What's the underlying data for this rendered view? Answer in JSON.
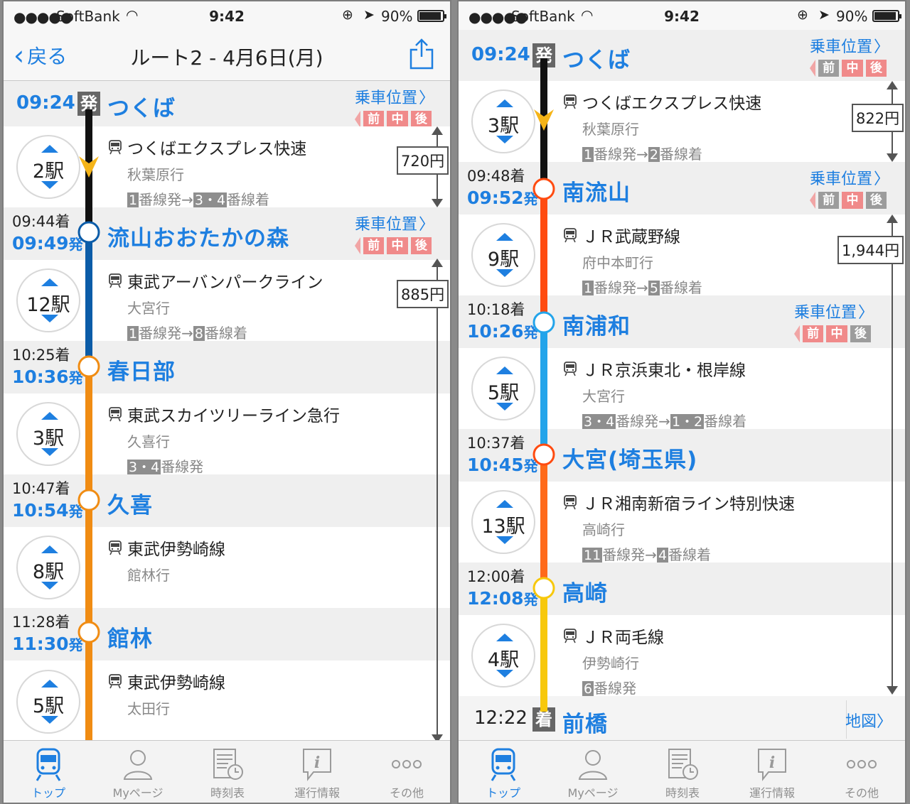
{
  "status": {
    "signal": "●●●●●",
    "carrier": "SoftBank",
    "time": "9:42",
    "battery": "90%"
  },
  "nav": {
    "back": "戻る",
    "title": "ルート2 - 4月6日(月)"
  },
  "car_position": {
    "label": "乗車位置",
    "front": "前",
    "middle": "中",
    "rear": "後"
  },
  "dep_suffix": "発",
  "arr_suffix": "着",
  "map_link": "地図",
  "colors": {
    "accent": "#1e7fe0",
    "tx": "#111111",
    "tobu_urban": "#0b5ca8",
    "tobu": "#f08c13",
    "musashino": "#ff4b10",
    "keihin": "#23a4ea",
    "shonan": "#ff6a1a",
    "ryomo": "#f7c80c"
  },
  "screen1": {
    "origin": {
      "time": "09:24",
      "tag": "発",
      "name": "つくば"
    },
    "legs": [
      {
        "stops": "2駅",
        "train": "つくばエクスプレス快速",
        "dest": "秋葉原行",
        "plat_from": "1",
        "plat_to": "3・4",
        "plat_from_label": "番線発→",
        "plat_to_label": "番線着"
      },
      {
        "stops": "12駅",
        "train": "東武アーバンパークライン",
        "dest": "大宮行",
        "plat_from": "1",
        "plat_to": "8",
        "plat_from_label": "番線発→",
        "plat_to_label": "番線着"
      },
      {
        "stops": "3駅",
        "train": "東武スカイツリーライン急行",
        "dest": "久喜行",
        "plat_from": "3・4",
        "plat_from_label": "番線発"
      },
      {
        "stops": "8駅",
        "train": "東武伊勢崎線",
        "dest": "館林行"
      },
      {
        "stops": "5駅",
        "train": "東武伊勢崎線",
        "dest": "太田行"
      }
    ],
    "stations": [
      {
        "arr": "09:44",
        "dep": "09:49",
        "name": "流山おおたかの森"
      },
      {
        "arr": "10:25",
        "dep": "10:36",
        "name": "春日部"
      },
      {
        "arr": "10:47",
        "dep": "10:54",
        "name": "久喜"
      },
      {
        "arr": "11:28",
        "dep": "11:30",
        "name": "館林"
      }
    ],
    "fares": [
      "720円",
      "885円"
    ]
  },
  "screen2": {
    "origin": {
      "time": "09:24",
      "tag": "発",
      "name": "つくば"
    },
    "legs": [
      {
        "stops": "3駅",
        "train": "つくばエクスプレス快速",
        "dest": "秋葉原行",
        "plat_from": "1",
        "plat_to": "2",
        "plat_from_label": "番線発→",
        "plat_to_label": "番線着"
      },
      {
        "stops": "9駅",
        "train": "ＪＲ武蔵野線",
        "dest": "府中本町行",
        "plat_from": "1",
        "plat_to": "5",
        "plat_from_label": "番線発→",
        "plat_to_label": "番線着"
      },
      {
        "stops": "5駅",
        "train": "ＪＲ京浜東北・根岸線",
        "dest": "大宮行",
        "plat_from": "3・4",
        "plat_to": "1・2",
        "plat_from_label": "番線発→",
        "plat_to_label": "番線着"
      },
      {
        "stops": "13駅",
        "train": "ＪＲ湘南新宿ライン特別快速",
        "dest": "高崎行",
        "plat_from": "11",
        "plat_to": "4",
        "plat_from_label": "番線発→",
        "plat_to_label": "番線着"
      },
      {
        "stops": "4駅",
        "train": "ＪＲ両毛線",
        "dest": "伊勢崎行",
        "plat_from": "6",
        "plat_from_label": "番線発"
      }
    ],
    "stations": [
      {
        "arr": "09:48",
        "dep": "09:52",
        "name": "南流山"
      },
      {
        "arr": "10:18",
        "dep": "10:26",
        "name": "南浦和"
      },
      {
        "arr": "10:37",
        "dep": "10:45",
        "name": "大宮(埼玉県)"
      },
      {
        "arr": "12:00",
        "dep": "12:08",
        "name": "高崎"
      }
    ],
    "destination": {
      "time": "12:22",
      "tag": "着",
      "name": "前橋"
    },
    "fares": [
      "822円",
      "1,944円"
    ]
  },
  "tabs": [
    {
      "label": "トップ",
      "icon": "train-icon",
      "selected": true
    },
    {
      "label": "Myページ",
      "icon": "person-icon"
    },
    {
      "label": "時刻表",
      "icon": "timetable-icon"
    },
    {
      "label": "運行情報",
      "icon": "info-icon"
    },
    {
      "label": "その他",
      "icon": "more-icon"
    }
  ]
}
